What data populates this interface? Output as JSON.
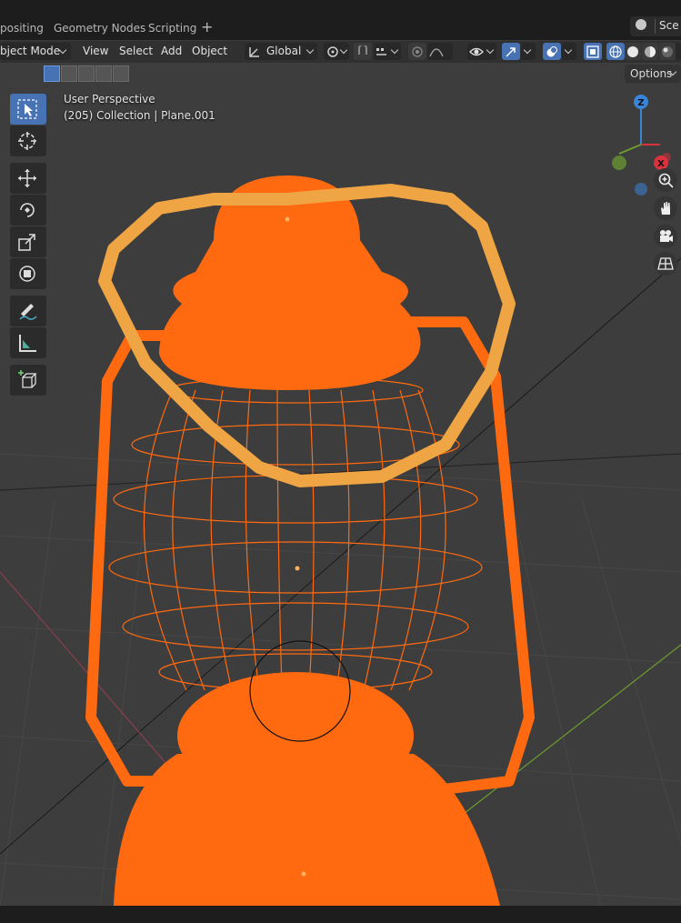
{
  "workspace_tabs": [
    "positing",
    "Geometry Nodes",
    "Scripting"
  ],
  "scene_label": "Sce",
  "header": {
    "mode": "bject Mode",
    "menus": [
      "View",
      "Select",
      "Add",
      "Object"
    ],
    "transform_orientation": "Global"
  },
  "viewport": {
    "view_name": "User Perspective",
    "collection_info": "(205) Collection | Plane.001",
    "options_label": "Options"
  },
  "gizmo": {
    "z_label": "Z",
    "x_label": "X",
    "colors": {
      "x": "#d9323f",
      "y": "#6c9e2f",
      "z": "#3a84d8"
    }
  },
  "colors": {
    "selection": "#ff6a10",
    "active_handle": "#f0a545",
    "accent": "#4772b3",
    "viewport_bg": "#3d3d3d"
  },
  "tools": [
    "select-box-icon",
    "cursor-icon",
    "move-icon",
    "rotate-icon",
    "scale-icon",
    "transform-icon",
    "annotate-icon",
    "measure-icon",
    "add-cube-icon"
  ],
  "nav_buttons": [
    "zoom-icon",
    "hand-icon",
    "camera-icon",
    "grid-icon"
  ]
}
